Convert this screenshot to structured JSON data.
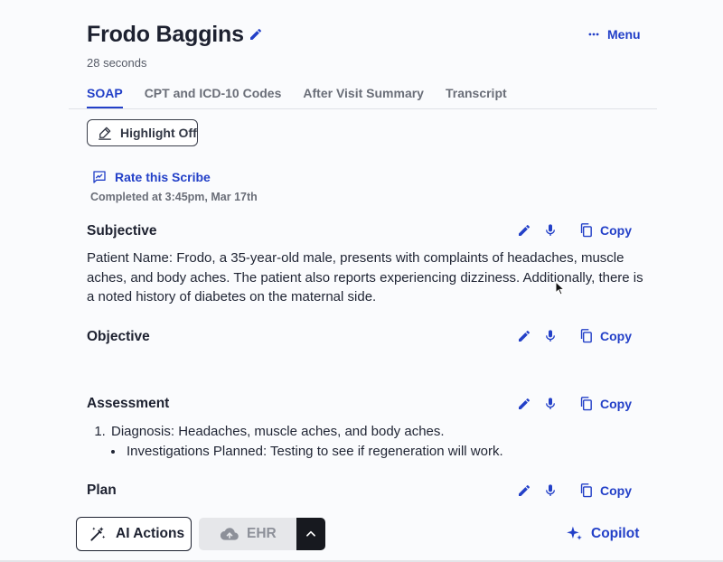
{
  "header": {
    "patient_name": "Frodo Baggins",
    "duration": "28 seconds",
    "menu_label": "Menu"
  },
  "tabs": [
    {
      "label": "SOAP",
      "active": true
    },
    {
      "label": "CPT and ICD-10 Codes",
      "active": false
    },
    {
      "label": "After Visit Summary",
      "active": false
    },
    {
      "label": "Transcript",
      "active": false
    }
  ],
  "toolbar": {
    "highlight_label": "Highlight Off",
    "rate_label": "Rate this Scribe",
    "completed_text": "Completed at 3:45pm, Mar 17th"
  },
  "sections": {
    "subjective": {
      "title": "Subjective",
      "copy_label": "Copy",
      "text": "Patient Name: Frodo, a 35-year-old male, presents with complaints of headaches, muscle aches, and body aches. The patient also reports experiencing dizziness. Additionally, there is a noted history of diabetes on the maternal side."
    },
    "objective": {
      "title": "Objective",
      "copy_label": "Copy",
      "text": ""
    },
    "assessment": {
      "title": "Assessment",
      "copy_label": "Copy",
      "items": [
        {
          "text": "Diagnosis: Headaches, muscle aches, and body aches.",
          "subitems": [
            "Investigations Planned: Testing to see if regeneration will work."
          ]
        }
      ]
    },
    "plan": {
      "title": "Plan",
      "copy_label": "Copy"
    }
  },
  "footer": {
    "ai_actions_label": "AI Actions",
    "ehr_label": "EHR",
    "copilot_label": "Copilot"
  },
  "colors": {
    "accent": "#2340c8",
    "text": "#1d2130",
    "muted": "#6a6e78",
    "disabled_bg": "#e6e7ea",
    "dark_button": "#17191f"
  },
  "icons": {
    "title_edit": "pencil-icon",
    "menu": "more-horizontal-icon",
    "highlight": "highlighter-icon",
    "rate": "feedback-icon",
    "edit": "pencil-icon",
    "dictate": "microphone-icon",
    "copy": "copy-icon",
    "ai_actions": "magic-wand-icon",
    "ehr": "cloud-upload-icon",
    "ehr_toggle": "chevron-up-icon",
    "copilot": "sparkle-icon"
  }
}
